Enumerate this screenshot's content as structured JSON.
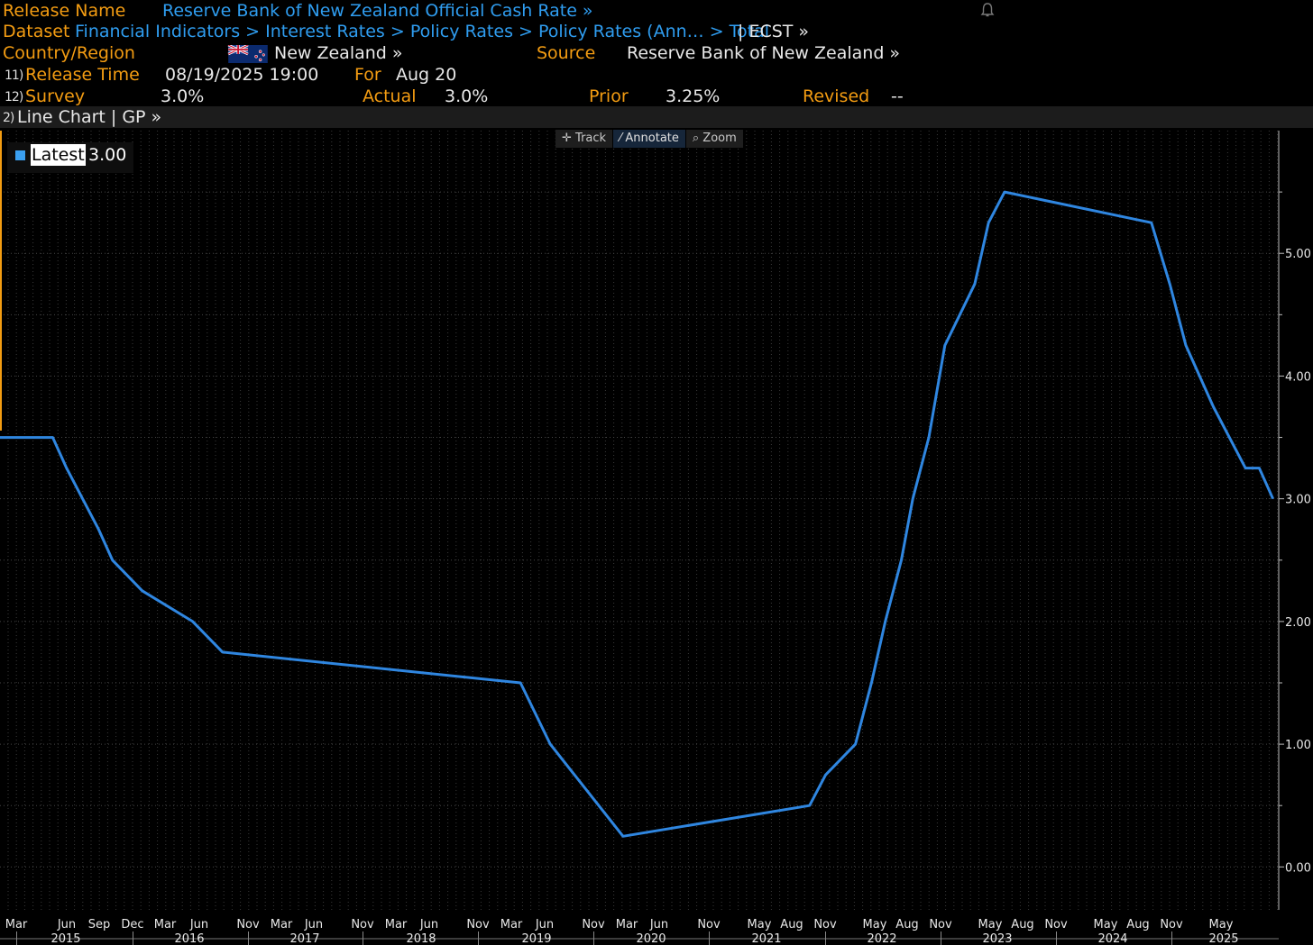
{
  "header": {
    "release_name_label": "Release Name",
    "release_name_value": "Reserve Bank of New Zealand Official Cash Rate »",
    "dataset_label": "Dataset",
    "dataset_path": "Financial Indicators > Interest Rates > Policy Rates > Policy Rates (Ann…  > Total",
    "dataset_ticker": "| ECST »",
    "country_label": "Country/Region",
    "country_value": "New Zealand »",
    "source_label": "Source",
    "source_value": "Reserve Bank of New Zealand »",
    "release_time_num": "11)",
    "release_time_label": "Release Time",
    "release_time_value": "08/19/2025 19:00",
    "for_label": "For",
    "for_value": "Aug 20",
    "survey_num": "12)",
    "survey_label": "Survey",
    "survey_value": "3.0%",
    "actual_label": "Actual",
    "actual_value": "3.0%",
    "prior_label": "Prior",
    "prior_value": "3.25%",
    "revised_label": "Revised",
    "revised_value": "--",
    "chart_menu_num": "2)",
    "chart_menu_label": "Line Chart | GP »"
  },
  "toolbar": {
    "track": "Track",
    "annotate": "Annotate",
    "zoom": "Zoom"
  },
  "legend": {
    "label": "Latest",
    "value": "3.00"
  },
  "colors": {
    "line": "#2f86e0",
    "orange": "#f39c12",
    "link": "#2f9df0"
  },
  "chart_data": {
    "type": "line",
    "title": "",
    "xlabel": "",
    "ylabel": "",
    "ylim": [
      -0.35,
      6.0
    ],
    "y_ticks": [
      "0.00",
      "1.00",
      "2.00",
      "3.00",
      "4.00",
      "5.00"
    ],
    "x_month_labels": [
      "Mar",
      "Jun",
      "Sep",
      "Dec",
      "Mar",
      "Jun",
      "Nov",
      "Mar",
      "Jun",
      "Nov",
      "Mar",
      "Jun",
      "Nov",
      "Mar",
      "Jun",
      "Nov",
      "Mar",
      "Jun",
      "Nov",
      "May",
      "Aug",
      "Nov",
      "May",
      "Aug",
      "Nov",
      "May",
      "Aug",
      "Nov",
      "May",
      "Aug",
      "Nov",
      "May"
    ],
    "x_year_labels": [
      "2015",
      "2016",
      "2017",
      "2018",
      "2019",
      "2020",
      "2021",
      "2022",
      "2023",
      "2024",
      "2025"
    ],
    "series": [
      {
        "name": "Latest",
        "points": [
          [
            "2015-01-01",
            3.5
          ],
          [
            "2015-06-11",
            3.5
          ],
          [
            "2015-07-23",
            3.25
          ],
          [
            "2015-09-10",
            3.0
          ],
          [
            "2015-10-29",
            2.75
          ],
          [
            "2015-12-10",
            2.5
          ],
          [
            "2016-03-10",
            2.25
          ],
          [
            "2016-08-11",
            2.0
          ],
          [
            "2016-11-10",
            1.75
          ],
          [
            "2019-05-08",
            1.5
          ],
          [
            "2019-08-07",
            1.0
          ],
          [
            "2020-03-16",
            0.25
          ],
          [
            "2021-10-06",
            0.5
          ],
          [
            "2021-11-24",
            0.75
          ],
          [
            "2022-02-23",
            1.0
          ],
          [
            "2022-04-13",
            1.5
          ],
          [
            "2022-05-25",
            2.0
          ],
          [
            "2022-07-13",
            2.5
          ],
          [
            "2022-08-17",
            3.0
          ],
          [
            "2022-10-05",
            3.5
          ],
          [
            "2022-11-23",
            4.25
          ],
          [
            "2023-02-22",
            4.75
          ],
          [
            "2023-04-05",
            5.25
          ],
          [
            "2023-05-24",
            5.5
          ],
          [
            "2024-08-14",
            5.25
          ],
          [
            "2024-10-09",
            4.75
          ],
          [
            "2024-11-27",
            4.25
          ],
          [
            "2025-02-19",
            3.75
          ],
          [
            "2025-04-09",
            3.5
          ],
          [
            "2025-05-28",
            3.25
          ],
          [
            "2025-07-09",
            3.25
          ],
          [
            "2025-08-20",
            3.0
          ]
        ]
      }
    ]
  }
}
